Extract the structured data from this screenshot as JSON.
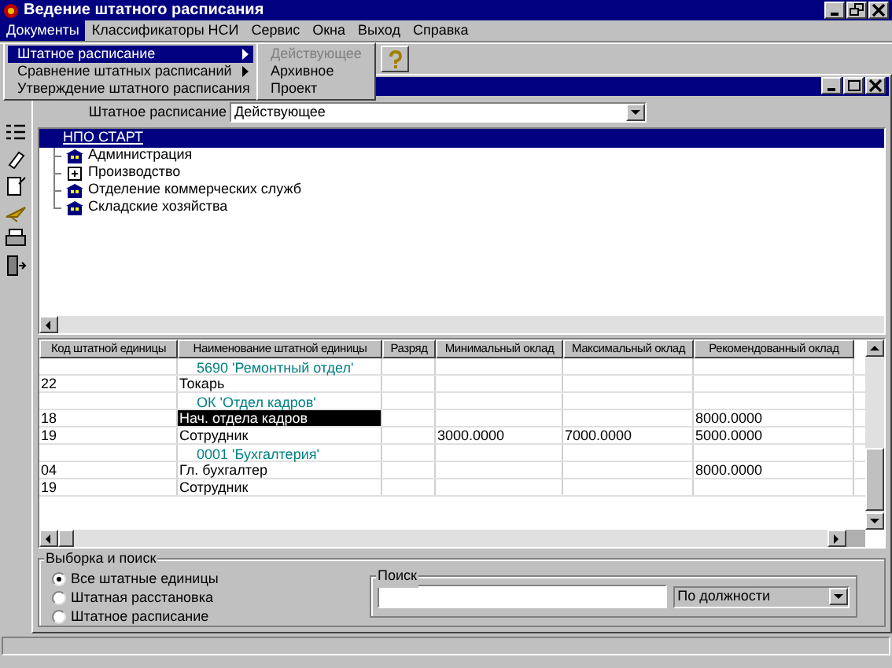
{
  "window": {
    "title": "Ведение штатного расписания"
  },
  "menu": [
    {
      "label": "Документы",
      "selected": true
    },
    {
      "label": "Классификаторы НСИ",
      "selected": false
    },
    {
      "label": "Сервис",
      "selected": false
    },
    {
      "label": "Окна",
      "selected": false
    },
    {
      "label": "Выход",
      "selected": false
    },
    {
      "label": "Справка",
      "selected": false
    }
  ],
  "dropdown": [
    {
      "label": "Штатное расписание",
      "kind": "submenu",
      "selected": true
    },
    {
      "label": "Сравнение штатных расписаний",
      "kind": "submenu",
      "selected": false
    },
    {
      "label": "Утверждение штатного расписания",
      "kind": "command",
      "selected": false
    }
  ],
  "submenu": [
    {
      "label": "Действующее",
      "disabled": true
    },
    {
      "label": "Архивное",
      "disabled": false
    },
    {
      "label": "Проект",
      "disabled": false
    }
  ],
  "filter": {
    "label": "Штатное расписание",
    "value": "Действующее"
  },
  "tree": {
    "root": {
      "label": "НПО СТАРТ",
      "selected": true
    },
    "children": [
      {
        "label": "Администрация",
        "kind": "unit"
      },
      {
        "label": "Производство",
        "kind": "collapsed"
      },
      {
        "label": "Отделение коммерческих служб",
        "kind": "unit"
      },
      {
        "label": "Складские хозяйства",
        "kind": "unit"
      }
    ]
  },
  "table": {
    "columns": [
      "Код штатной единицы",
      "Наименование штатной единицы",
      "Разряд",
      "Минимальный оклад",
      "Максимальный оклад",
      "Рекомендованный оклад"
    ],
    "rows": [
      {
        "kind": "group",
        "label": "5690 'Ремонтный отдел'"
      },
      {
        "kind": "item",
        "selected": false,
        "cells": [
          "22",
          "Токарь",
          "",
          "",
          "",
          ""
        ]
      },
      {
        "kind": "group",
        "label": "ОК 'Отдел кадров'"
      },
      {
        "kind": "item",
        "selected": true,
        "cells": [
          "18",
          "Нач. отдела кадров",
          "",
          "",
          "",
          "8000.0000"
        ]
      },
      {
        "kind": "item",
        "selected": false,
        "cells": [
          "19",
          "Сотрудник",
          "",
          "3000.0000",
          "7000.0000",
          "5000.0000"
        ]
      },
      {
        "kind": "group",
        "label": "0001 'Бухгалтерия'"
      },
      {
        "kind": "item",
        "selected": false,
        "cells": [
          "04",
          "Гл. бухгалтер",
          "",
          "",
          "",
          "8000.0000"
        ]
      },
      {
        "kind": "item",
        "selected": false,
        "cells": [
          "19",
          "Сотрудник",
          "",
          "",
          "",
          ""
        ]
      }
    ]
  },
  "selection": {
    "title": "Выборка и поиск",
    "options": [
      {
        "label": "Все штатные единицы",
        "selected": true
      },
      {
        "label": "Штатная расстановка",
        "selected": false
      },
      {
        "label": "Штатное расписание",
        "selected": false
      }
    ]
  },
  "search": {
    "title": "Поиск",
    "mode": "По должности"
  }
}
